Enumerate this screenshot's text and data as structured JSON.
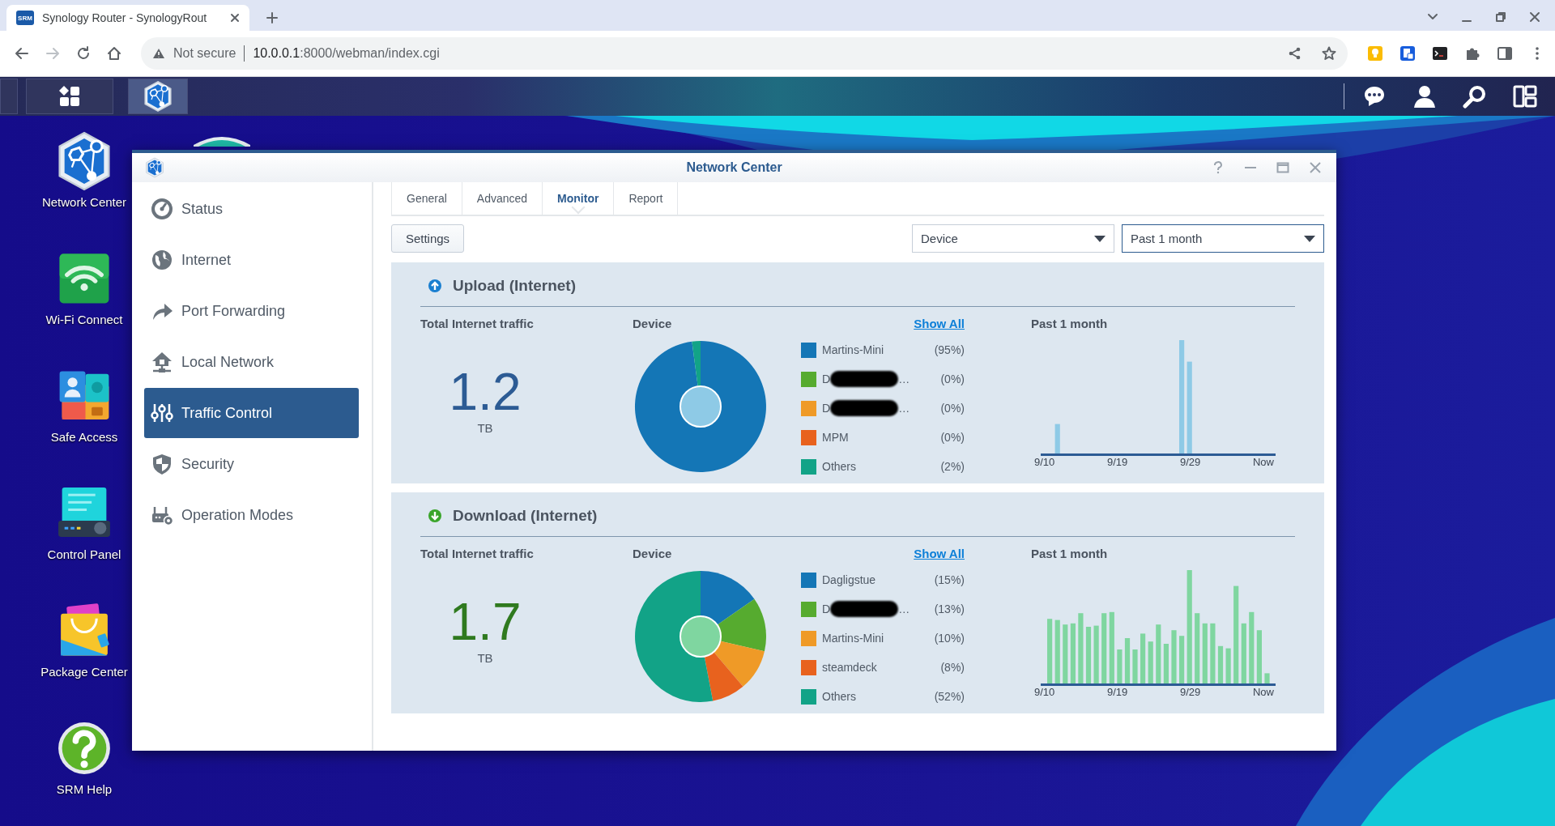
{
  "browser": {
    "tab": {
      "favicon": "SRM",
      "title": "Synology Router - SynologyRout",
      "selected": true
    },
    "address": {
      "security": "Not secure",
      "host": "10.0.0.1",
      "path": ":8000/webman/index.cgi"
    }
  },
  "desktop": {
    "icons": [
      {
        "kind": "network",
        "label": "Network Center"
      },
      {
        "kind": "wifi",
        "label": "Wi-Fi Connect"
      },
      {
        "kind": "safe",
        "label": "Safe Access"
      },
      {
        "kind": "control",
        "label": "Control Panel"
      },
      {
        "kind": "package",
        "label": "Package Center"
      },
      {
        "kind": "help",
        "label": "SRM Help"
      }
    ]
  },
  "window": {
    "title": "Network Center",
    "sidebar": [
      {
        "kind": "status",
        "label": "Status",
        "selected": false
      },
      {
        "kind": "internet",
        "label": "Internet",
        "selected": false
      },
      {
        "kind": "forward",
        "label": "Port Forwarding",
        "selected": false
      },
      {
        "kind": "local",
        "label": "Local Network",
        "selected": false
      },
      {
        "kind": "traffic",
        "label": "Traffic Control",
        "selected": true
      },
      {
        "kind": "security",
        "label": "Security",
        "selected": false
      },
      {
        "kind": "modes",
        "label": "Operation Modes",
        "selected": false
      }
    ],
    "tabs": [
      {
        "label": "General",
        "selected": false
      },
      {
        "label": "Advanced",
        "selected": false
      },
      {
        "label": "Monitor",
        "selected": true
      },
      {
        "label": "Report",
        "selected": false
      }
    ],
    "settings_button": "Settings",
    "filters": [
      {
        "value": "Device",
        "focused": false
      },
      {
        "value": "Past 1 month",
        "focused": true
      }
    ],
    "sections": [
      {
        "kind": "upload",
        "title": "Upload (Internet)",
        "total_label": "Total Internet traffic",
        "total": "1.2",
        "unit": "TB",
        "device_label": "Device",
        "show_all": "Show All",
        "period_label": "Past 1 month",
        "x_labels": [
          "9/10",
          "9/19",
          "9/29",
          "Now"
        ],
        "legend": [
          {
            "name": "Martins-Mini",
            "share": "(95%)",
            "color": "#1476b6",
            "redacted": false
          },
          {
            "name": "D",
            "trail": "…",
            "share": "(0%)",
            "color": "#56ab2f",
            "redacted": true
          },
          {
            "name": "D",
            "trail": "…",
            "share": "(0%)",
            "color": "#ef9a27",
            "redacted": true
          },
          {
            "name": "MPM",
            "share": "(0%)",
            "color": "#e8621e",
            "redacted": false
          },
          {
            "name": "Others",
            "share": "(2%)",
            "color": "#12a387",
            "redacted": false
          }
        ],
        "chart_data": {
          "type": "donut",
          "values": [
            97.9,
            0,
            0,
            0,
            2.1
          ]
        }
      },
      {
        "kind": "download",
        "title": "Download (Internet)",
        "total_label": "Total Internet traffic",
        "total": "1.7",
        "unit": "TB",
        "device_label": "Device",
        "show_all": "Show All",
        "period_label": "Past 1 month",
        "x_labels": [
          "9/10",
          "9/19",
          "9/29",
          "Now"
        ],
        "legend": [
          {
            "name": "Dagligstue",
            "share": "(15%)",
            "color": "#1476b6",
            "redacted": false
          },
          {
            "name": "D",
            "trail": "…",
            "share": "(13%)",
            "color": "#56ab2f",
            "redacted": true
          },
          {
            "name": "Martins-Mini",
            "share": "(10%)",
            "color": "#ef9a27",
            "redacted": false
          },
          {
            "name": "steamdeck",
            "share": "(8%)",
            "color": "#e8621e",
            "redacted": false
          },
          {
            "name": "Others",
            "share": "(52%)",
            "color": "#12a387",
            "redacted": false
          }
        ],
        "chart_data": {
          "type": "donut",
          "values": [
            15.3,
            13.3,
            10.2,
            8.2,
            53.0
          ]
        }
      }
    ]
  }
}
